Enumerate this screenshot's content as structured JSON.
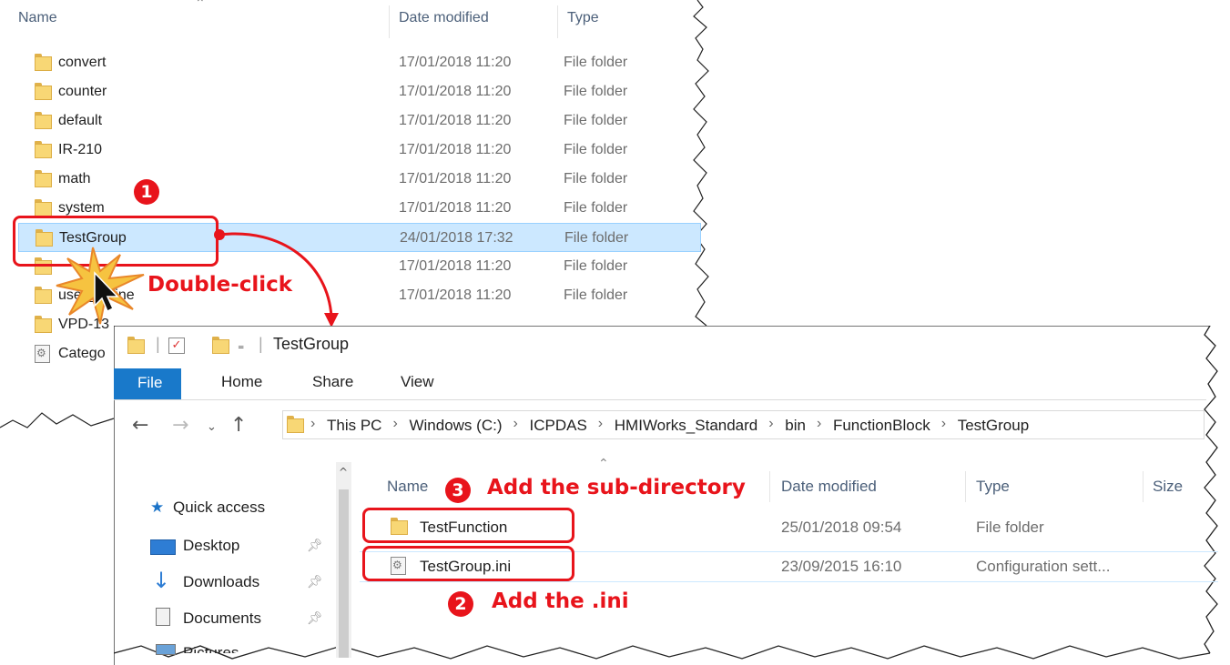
{
  "back_window": {
    "headers": {
      "name": "Name",
      "date": "Date modified",
      "type": "Type"
    },
    "rows": [
      {
        "name": "convert",
        "date": "17/01/2018 11:20",
        "type": "File folder",
        "icon": "folder-icon"
      },
      {
        "name": "counter",
        "date": "17/01/2018 11:20",
        "type": "File folder",
        "icon": "folder-icon"
      },
      {
        "name": "default",
        "date": "17/01/2018 11:20",
        "type": "File folder",
        "icon": "folder-icon"
      },
      {
        "name": "IR-210",
        "date": "17/01/2018 11:20",
        "type": "File folder",
        "icon": "folder-icon"
      },
      {
        "name": "math",
        "date": "17/01/2018 11:20",
        "type": "File folder",
        "icon": "folder-icon"
      },
      {
        "name": "system",
        "date": "17/01/2018 11:20",
        "type": "File folder",
        "icon": "folder-icon"
      },
      {
        "name": "TestGroup",
        "date": "24/01/2018 17:32",
        "type": "File folder",
        "icon": "folder-icon",
        "selected": true
      },
      {
        "name": "",
        "date": "17/01/2018 11:20",
        "type": "File folder",
        "icon": "folder-icon"
      },
      {
        "name": "user_define",
        "date": "17/01/2018 11:20",
        "type": "File folder",
        "icon": "folder-icon"
      },
      {
        "name": "VPD-13",
        "date": "",
        "type": "",
        "icon": "folder-icon"
      },
      {
        "name": "Catego",
        "date": "",
        "type": "",
        "icon": "config-file-icon"
      }
    ]
  },
  "front_window": {
    "title": "TestGroup",
    "ribbon_tabs": [
      "File",
      "Home",
      "Share",
      "View"
    ],
    "breadcrumb": [
      "This PC",
      "Windows (C:)",
      "ICPDAS",
      "HMIWorks_Standard",
      "bin",
      "FunctionBlock",
      "TestGroup"
    ],
    "nav": [
      {
        "label": "Quick access",
        "icon": "star-icon"
      },
      {
        "label": "Desktop",
        "icon": "desktop-icon"
      },
      {
        "label": "Downloads",
        "icon": "download-arrow-icon"
      },
      {
        "label": "Documents",
        "icon": "document-icon"
      },
      {
        "label": "Pictures",
        "icon": "pictures-icon"
      }
    ],
    "headers": {
      "name": "Name",
      "date": "Date modified",
      "type": "Type",
      "size": "Size"
    },
    "rows": [
      {
        "name": "TestFunction",
        "date": "25/01/2018 09:54",
        "type": "File folder",
        "icon": "folder-icon"
      },
      {
        "name": "TestGroup.ini",
        "date": "23/09/2015 16:10",
        "type": "Configuration sett...",
        "icon": "config-file-icon"
      }
    ]
  },
  "annotations": {
    "step1_badge": "1",
    "step1_text": "Double-click",
    "step2_badge": "2",
    "step2_text": "Add the .ini",
    "step3_badge": "3",
    "step3_text": "Add the sub-directory"
  },
  "colors": {
    "accent": "#e8141b",
    "selection": "#cce8ff",
    "file_tab": "#1979ca"
  }
}
